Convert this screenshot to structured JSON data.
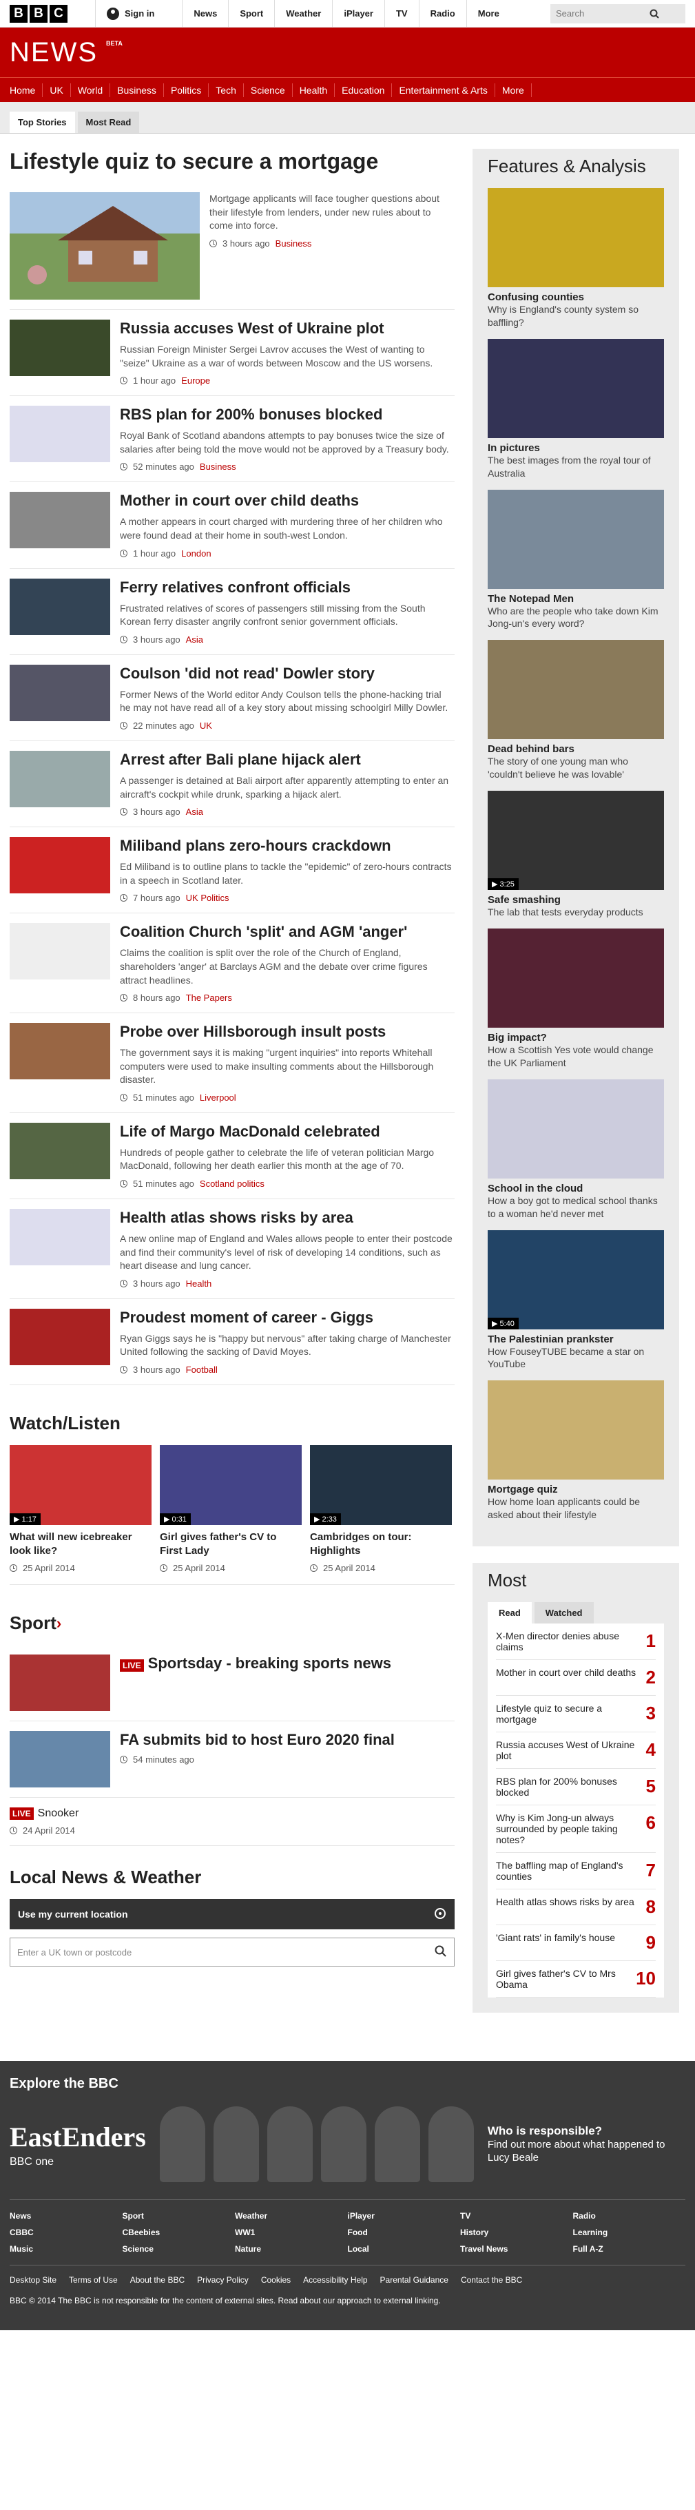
{
  "masthead": {
    "sign_in": "Sign in",
    "links": [
      "News",
      "Sport",
      "Weather",
      "iPlayer",
      "TV",
      "Radio",
      "More"
    ],
    "search_placeholder": "Search"
  },
  "brand": {
    "news": "NEWS",
    "beta": "BETA"
  },
  "nav": [
    "Home",
    "UK",
    "World",
    "Business",
    "Politics",
    "Tech",
    "Science",
    "Health",
    "Education",
    "Entertainment & Arts",
    "More"
  ],
  "subtabs": [
    "Top Stories",
    "Most Read"
  ],
  "lead": {
    "title": "Lifestyle quiz to secure a mortgage",
    "summary": "Mortgage applicants will face tougher questions about their lifestyle from lenders, under new rules about to come into force.",
    "time": "3 hours ago",
    "section": "Business"
  },
  "stories": [
    {
      "title": "Russia accuses West of Ukraine plot",
      "summary": "Russian Foreign Minister Sergei Lavrov accuses the West of wanting to \"seize\" Ukraine as a war of words between Moscow and the US worsens.",
      "time": "1 hour ago",
      "section": "Europe"
    },
    {
      "title": "RBS plan for 200% bonuses blocked",
      "summary": "Royal Bank of Scotland abandons attempts to pay bonuses twice the size of salaries after being told the move would not be approved by a Treasury body.",
      "time": "52 minutes ago",
      "section": "Business"
    },
    {
      "title": "Mother in court over child deaths",
      "summary": "A mother appears in court charged with murdering three of her children who were found dead at their home in south-west London.",
      "time": "1 hour ago",
      "section": "London"
    },
    {
      "title": "Ferry relatives confront officials",
      "summary": "Frustrated relatives of scores of passengers still missing from the South Korean ferry disaster angrily confront senior government officials.",
      "time": "3 hours ago",
      "section": "Asia"
    },
    {
      "title": "Coulson 'did not read' Dowler story",
      "summary": "Former News of the World editor Andy Coulson tells the phone-hacking trial he may not have read all of a key story about missing schoolgirl Milly Dowler.",
      "time": "22 minutes ago",
      "section": "UK"
    },
    {
      "title": "Arrest after Bali plane hijack alert",
      "summary": "A passenger is detained at Bali airport after apparently attempting to enter an aircraft's cockpit while drunk, sparking a hijack alert.",
      "time": "3 hours ago",
      "section": "Asia"
    },
    {
      "title": "Miliband plans zero-hours crackdown",
      "summary": "Ed Miliband is to outline plans to tackle the \"epidemic\" of zero-hours contracts in a speech in Scotland later.",
      "time": "7 hours ago",
      "section": "UK Politics"
    },
    {
      "title": "Coalition Church 'split' and AGM 'anger'",
      "summary": "Claims the coalition is split over the role of the Church of England, shareholders 'anger' at Barclays AGM and the debate over crime figures attract headlines.",
      "time": "8 hours ago",
      "section": "The Papers"
    },
    {
      "title": "Probe over Hillsborough insult posts",
      "summary": "The government says it is making \"urgent inquiries\" into reports Whitehall computers were used to make insulting comments about the Hillsborough disaster.",
      "time": "51 minutes ago",
      "section": "Liverpool"
    },
    {
      "title": "Life of Margo MacDonald celebrated",
      "summary": "Hundreds of people gather to celebrate the life of veteran politician Margo MacDonald, following her death earlier this month at the age of 70.",
      "time": "51 minutes ago",
      "section": "Scotland politics"
    },
    {
      "title": "Health atlas shows risks by area",
      "summary": "A new online map of England and Wales allows people to enter their postcode and find their community's level of risk of developing 14 conditions, such as heart disease and lung cancer.",
      "time": "3 hours ago",
      "section": "Health"
    },
    {
      "title": "Proudest moment of career - Giggs",
      "summary": "Ryan Giggs says he is \"happy but nervous\" after taking charge of Manchester United following the sacking of David Moyes.",
      "time": "3 hours ago",
      "section": "Football"
    }
  ],
  "watch": {
    "heading": "Watch/Listen",
    "items": [
      {
        "title": "What will new icebreaker look like?",
        "duration": "1:17",
        "date": "25 April 2014"
      },
      {
        "title": "Girl gives father's CV to First Lady",
        "duration": "0:31",
        "date": "25 April 2014"
      },
      {
        "title": "Cambridges on tour: Highlights",
        "duration": "2:33",
        "date": "25 April 2014"
      }
    ]
  },
  "sport": {
    "heading": "Sport",
    "live": "LIVE",
    "items": [
      {
        "title": "Sportsday - breaking sports news",
        "live": true,
        "time": ""
      },
      {
        "title": "FA submits bid to host Euro 2020 final",
        "live": false,
        "time": "54 minutes ago"
      }
    ],
    "snooker": {
      "title": "Snooker",
      "date": "24 April 2014"
    }
  },
  "local": {
    "heading": "Local News & Weather",
    "location_button": "Use my current location",
    "placeholder": "Enter a UK town or postcode"
  },
  "features": {
    "heading": "Features & Analysis",
    "items": [
      {
        "title": "Confusing counties",
        "summary": "Why is England's county system so baffling?",
        "duration": ""
      },
      {
        "title": "In pictures",
        "summary": "The best images from the royal tour of Australia",
        "duration": ""
      },
      {
        "title": "The Notepad Men",
        "summary": "Who are the people who take down Kim Jong-un's every word?",
        "duration": ""
      },
      {
        "title": "Dead behind bars",
        "summary": "The story of one young man who 'couldn't believe he was lovable'",
        "duration": ""
      },
      {
        "title": "Safe smashing",
        "summary": "The lab that tests everyday products",
        "duration": "3:25"
      },
      {
        "title": "Big impact?",
        "summary": "How a Scottish Yes vote would change the UK Parliament",
        "duration": ""
      },
      {
        "title": "School in the cloud",
        "summary": "How a boy got to medical school thanks to a woman he'd never met",
        "duration": ""
      },
      {
        "title": "The Palestinian prankster",
        "summary": "How FouseyTUBE became a star on YouTube",
        "duration": "5:40"
      },
      {
        "title": "Mortgage quiz",
        "summary": "How home loan applicants could be asked about their lifestyle",
        "duration": ""
      }
    ]
  },
  "most": {
    "heading": "Most",
    "tabs": [
      "Read",
      "Watched"
    ],
    "items": [
      {
        "title": "X-Men director denies abuse claims",
        "n": "1"
      },
      {
        "title": "Mother in court over child deaths",
        "n": "2"
      },
      {
        "title": "Lifestyle quiz to secure a mortgage",
        "n": "3"
      },
      {
        "title": "Russia accuses West of Ukraine plot",
        "n": "4"
      },
      {
        "title": "RBS plan for 200% bonuses blocked",
        "n": "5"
      },
      {
        "title": "Why is Kim Jong-un always surrounded by people taking notes?",
        "n": "6"
      },
      {
        "title": "The baffling map of England's counties",
        "n": "7"
      },
      {
        "title": "Health atlas shows risks by area",
        "n": "8"
      },
      {
        "title": "'Giant rats' in family's house",
        "n": "9"
      },
      {
        "title": "Girl gives father's CV to Mrs Obama",
        "n": "10"
      }
    ]
  },
  "explore": {
    "heading": "Explore the BBC",
    "promo_brand": "EastEnders",
    "promo_channel": "BBC one",
    "promo_title": "Who is responsible?",
    "promo_text": "Find out more about what happened to Lucy Beale",
    "links": [
      "News",
      "Sport",
      "Weather",
      "iPlayer",
      "TV",
      "Radio",
      "CBBC",
      "CBeebies",
      "WW1",
      "Food",
      "History",
      "Learning",
      "Music",
      "Science",
      "Nature",
      "Local",
      "Travel News",
      "Full A-Z"
    ],
    "bottom": [
      "Desktop Site",
      "Terms of Use",
      "About the BBC",
      "Privacy Policy",
      "Cookies",
      "Accessibility Help",
      "Parental Guidance",
      "Contact the BBC"
    ],
    "copyright": "BBC © 2014 The BBC is not responsible for the content of external sites. Read about our approach to external linking."
  },
  "colors": {
    "brand_red": "#bb0000",
    "panel": "#ebebeb"
  }
}
